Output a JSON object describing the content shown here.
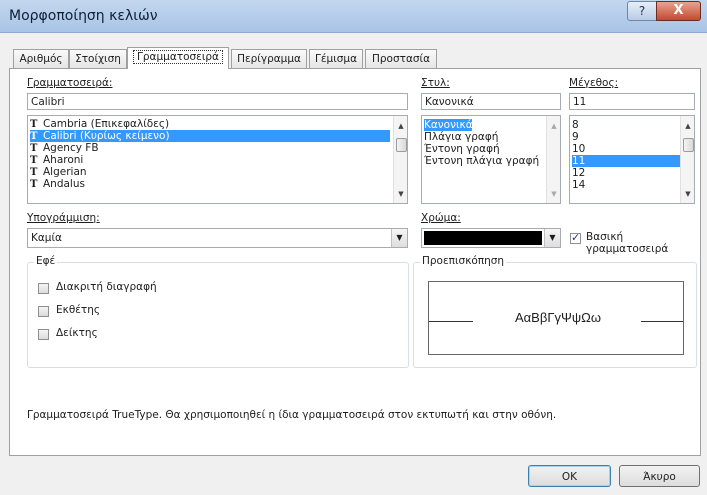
{
  "window": {
    "title": "Μορφοποίηση κελιών",
    "help_glyph": "?",
    "close_glyph": "X"
  },
  "tabs": [
    {
      "label": "Αριθμός"
    },
    {
      "label": "Στοίχιση"
    },
    {
      "label": "Γραμματοσειρά",
      "active": true
    },
    {
      "label": "Περίγραμμα"
    },
    {
      "label": "Γέμισμα"
    },
    {
      "label": "Προστασία"
    }
  ],
  "font": {
    "label": "Γραμματοσειρά:",
    "value": "Calibri",
    "list": [
      "Cambria (Επικεφαλίδες)",
      "Calibri (Κυρίως κείμενο)",
      "Agency FB",
      "Aharoni",
      "Algerian",
      "Andalus"
    ],
    "selected_index": 1,
    "icon_glyph": "T"
  },
  "style": {
    "label": "Στυλ:",
    "value": "Κανονικά",
    "list": [
      "Κανονικά",
      "Πλάγια γραφή",
      "Έντονη γραφή",
      "Έντονη πλάγια γραφή"
    ],
    "selected_index": 0
  },
  "size": {
    "label": "Μέγεθος:",
    "value": "11",
    "list": [
      "8",
      "9",
      "10",
      "11",
      "12",
      "14"
    ],
    "selected_index": 3
  },
  "underline": {
    "label": "Υπογράμμιση:",
    "value": "Καμία"
  },
  "color": {
    "label": "Χρώμα:",
    "swatch": "#000000"
  },
  "normal_font": {
    "label": "Βασική γραμματοσειρά",
    "checked": true
  },
  "effects": {
    "legend": "Εφέ",
    "items": [
      {
        "label": "Διακριτή διαγραφή",
        "checked": false
      },
      {
        "label": "Εκθέτης",
        "checked": false
      },
      {
        "label": "Δείκτης",
        "checked": false
      }
    ]
  },
  "preview": {
    "legend": "Προεπισκόπηση",
    "sample": "ΑαΒβΓγΨψΩω"
  },
  "info": "Γραμματοσειρά TrueType.  Θα χρησιμοποιηθεί η ίδια γραμματοσειρά στον εκτυπωτή και στην οθόνη.",
  "buttons": {
    "ok": "OK",
    "cancel": "Άκυρο"
  },
  "scroll_glyphs": {
    "up": "▲",
    "down": "▼"
  }
}
